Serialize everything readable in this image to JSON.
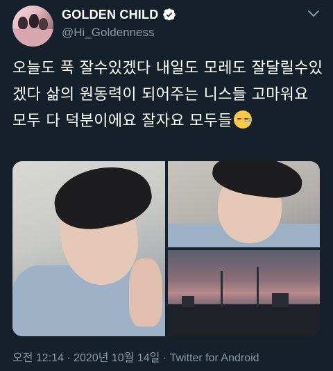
{
  "tweet": {
    "author_name": "GOLDEN CHILD",
    "author_handle": "@Hi_Goldenness",
    "text": "오늘도 푹 잘수있겠다 내일도 모레도  잘달릴수있겠다 삶의 원동력이 되어주는 니스들 고마워요 모두 다 덕분이에요 잘자요 모두들",
    "emoji": "sleeping-face",
    "timestamp": "오전 12:14 · 2020년 10월 14일 · Twitter for Android"
  },
  "colors": {
    "background": "#15202b",
    "primary_text": "#ffffff",
    "secondary_text": "#8899a6"
  },
  "icons": {
    "verified": "verified-badge-icon",
    "menu": "chevron-down-icon"
  }
}
